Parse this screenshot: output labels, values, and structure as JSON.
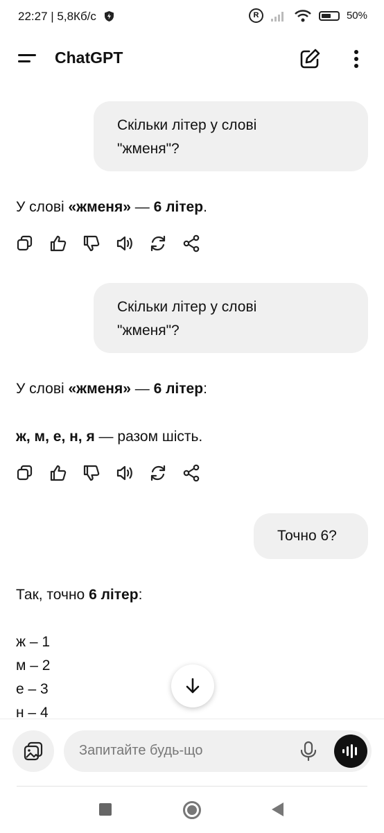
{
  "status_bar": {
    "time_speed": "22:27 | 5,8Кб/с",
    "battery": "50%"
  },
  "app_bar": {
    "title": "ChatGPT"
  },
  "conversation": {
    "q1": {
      "line1": "Скільки літер у слові",
      "line2": "\"жменя\"?"
    },
    "a1": {
      "pre": "У слові ",
      "word": "«жменя»",
      "dash": " — ",
      "count": "6 літер",
      "post": "."
    },
    "q2": {
      "line1": "Скільки літер у слові",
      "line2": "\"жменя\"?"
    },
    "a2": {
      "pre": "У слові ",
      "word": "«жменя»",
      "dash": " — ",
      "count": "6 літер",
      "post": ":",
      "letters": "ж, м, е, н, я",
      "letters_post": " — разом шість."
    },
    "q3": {
      "text": "Точно 6?"
    },
    "a3": {
      "pre": "Так, точно ",
      "count": "6 літер",
      "post": ":",
      "list": [
        "ж – 1",
        "м – 2",
        "е – 3",
        "н – 4"
      ]
    }
  },
  "composer": {
    "placeholder": "Запитайте будь-що"
  },
  "icons": {
    "actions": [
      "copy-icon",
      "thumbs-up-icon",
      "thumbs-down-icon",
      "read-aloud-icon",
      "regenerate-icon",
      "share-icon"
    ]
  }
}
